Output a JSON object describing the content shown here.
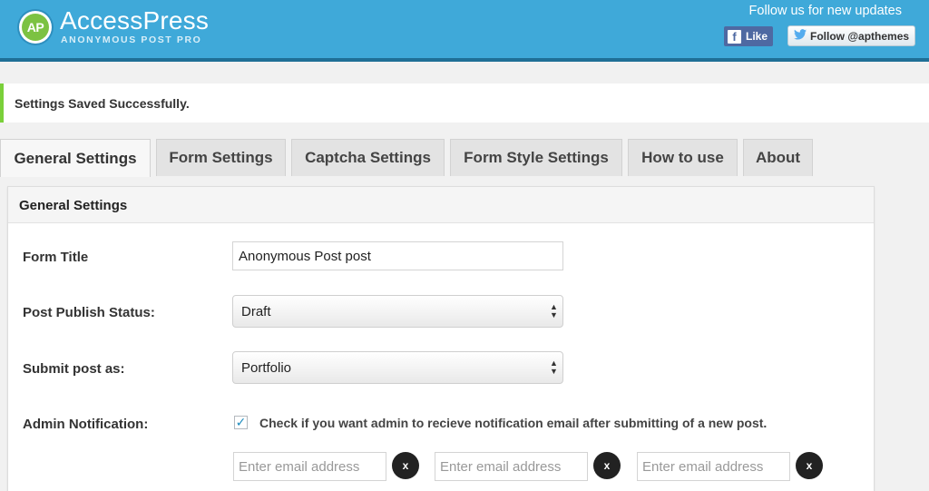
{
  "header": {
    "logo_badge": "AP",
    "logo_title": "AccessPress",
    "logo_subtitle": "ANONYMOUS POST PRO",
    "follow_text": "Follow us for new updates",
    "fb_icon": "f",
    "fb_like_label": "Like",
    "twitter_follow_label": "Follow @apthemes",
    "twitter_icon": "twitter-bird-icon",
    "header_color": "#3fa9d9"
  },
  "notice": {
    "message": "Settings Saved Successfully.",
    "accent_color": "#7ad03a"
  },
  "tabs": [
    {
      "label": "General Settings",
      "active": true
    },
    {
      "label": "Form Settings",
      "active": false
    },
    {
      "label": "Captcha Settings",
      "active": false
    },
    {
      "label": "Form Style Settings",
      "active": false
    },
    {
      "label": "How to use",
      "active": false
    },
    {
      "label": "About",
      "active": false
    }
  ],
  "panel": {
    "title": "General Settings",
    "form_title": {
      "label": "Form Title",
      "value": "Anonymous Post post"
    },
    "publish_status": {
      "label": "Post Publish Status:",
      "selected": "Draft"
    },
    "submit_as": {
      "label": "Submit post as:",
      "selected": "Portfolio"
    },
    "admin_notification": {
      "label": "Admin Notification:",
      "checked": true,
      "checkbox_label": "Check if you want admin to recieve notification email after submitting of a new post.",
      "email_placeholder": "Enter email address",
      "remove_label": "x"
    }
  }
}
